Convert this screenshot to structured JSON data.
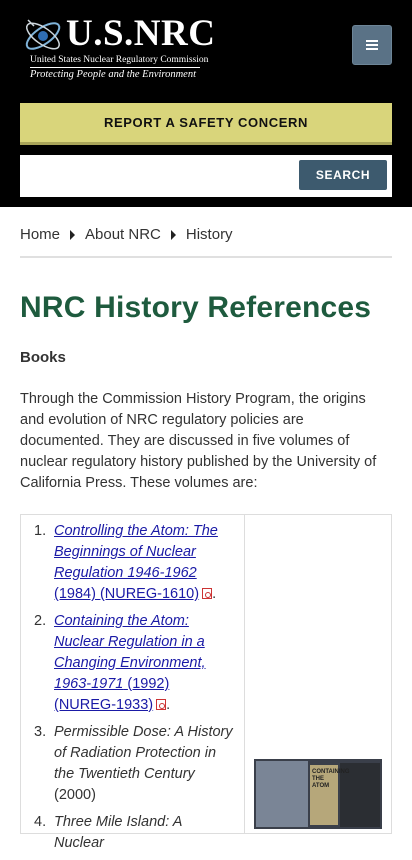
{
  "header": {
    "brand": "U.S.NRC",
    "subtitle": "United States Nuclear Regulatory Commission",
    "tagline": "Protecting People and the Environment",
    "report_label": "REPORT A SAFETY CONCERN",
    "search": {
      "placeholder": "",
      "value": "",
      "button_label": "SEARCH"
    }
  },
  "breadcrumb": [
    "Home",
    "About NRC",
    "History"
  ],
  "main": {
    "title": "NRC History References",
    "section_label": "Books",
    "intro": "Through the Commission History Program, the origins and evolution of NRC regulatory policies are documented. They are discussed in five volumes of nuclear regulatory history published by the University of California Press. These volumes are:",
    "references": [
      {
        "num": "1.",
        "title": "Controlling the Atom: The Beginnings of Nuclear Regulation 1946-1962",
        "detail": "(1984) (NUREG-1610)",
        "linked": true,
        "pdf": true,
        "suffix": "."
      },
      {
        "num": "2.",
        "title": "Containing the Atom: Nuclear Regulation in a Changing Environment, 1963-1971",
        "detail": "(1992) (NUREG-1933)",
        "linked": true,
        "pdf": true,
        "suffix": "."
      },
      {
        "num": "3.",
        "title": "Permissible Dose: A History of Radiation Protection in the Twentieth Century",
        "detail": "(2000)",
        "linked": false,
        "pdf": false,
        "suffix": ""
      },
      {
        "num": "4.",
        "title": "Three Mile Island: A Nuclear",
        "detail": "",
        "linked": false,
        "pdf": false,
        "suffix": ""
      }
    ],
    "book_cover_text": "CONTAINING THE ATOM"
  },
  "colors": {
    "title_green": "#1e5b3e",
    "report_yellow": "#d9d57b",
    "search_blue": "#3d5a6e",
    "link_blue": "#1a1aa6"
  }
}
